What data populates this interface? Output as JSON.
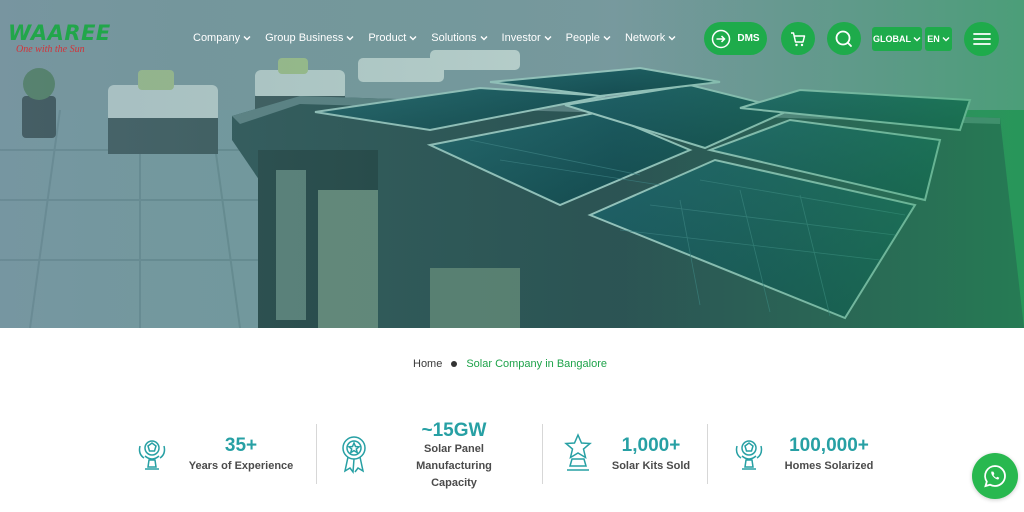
{
  "brand": {
    "name": "WAAREE",
    "tagline": "One with the Sun"
  },
  "nav": [
    {
      "label": "Company"
    },
    {
      "label": "Group Business"
    },
    {
      "label": "Product"
    },
    {
      "label": "Solutions"
    },
    {
      "label": "Investor"
    },
    {
      "label": "People"
    },
    {
      "label": "Network"
    }
  ],
  "header": {
    "dms_label": "DMS",
    "region_label": "GLOBAL",
    "language_label": "EN"
  },
  "colors": {
    "brand_green": "#1eab4b",
    "stat_teal": "#27a0a4",
    "logo_red": "#d2343a"
  },
  "breadcrumb": {
    "home": "Home",
    "current": "Solar Company in Bangalore"
  },
  "stats": [
    {
      "value": "35+",
      "label_lines": [
        "Years of Experience"
      ],
      "icon": "trophy-icon"
    },
    {
      "value": "~15GW",
      "label_lines": [
        "Solar Panel",
        "Manufacturing",
        "Capacity"
      ],
      "icon": "award-medal-icon"
    },
    {
      "value": "1,000+",
      "label_lines": [
        "Solar Kits Sold"
      ],
      "icon": "star-trophy-icon"
    },
    {
      "value": "100,000+",
      "label_lines": [
        "Homes Solarized"
      ],
      "icon": "trophy-icon"
    }
  ]
}
